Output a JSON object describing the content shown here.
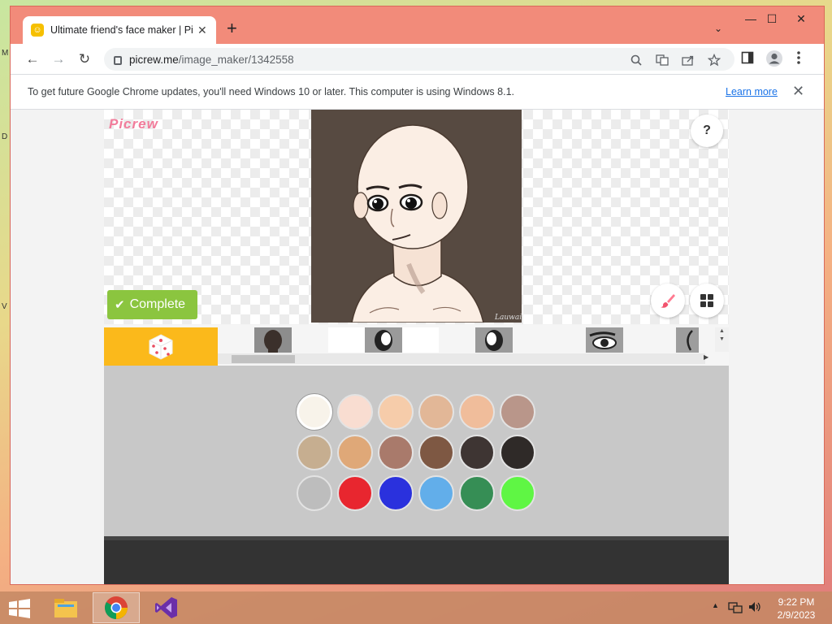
{
  "desktop": {
    "edge_letters": [
      "M",
      "D",
      "V"
    ]
  },
  "browser": {
    "tab": {
      "title": "Ultimate friend's face maker | Picrew",
      "close": "✕"
    },
    "new_tab": "+",
    "tab_search": "⌄",
    "window_controls": {
      "minimize": "—",
      "maximize": "☐",
      "close": "✕"
    },
    "nav": {
      "back": "←",
      "forward": "→",
      "reload": "↻"
    },
    "url_host": "picrew.me",
    "url_path": "/image_maker/1342558"
  },
  "infobar": {
    "message": "To get future Google Chrome updates, you'll need Windows 10 or later. This computer is using Windows 8.1.",
    "link": "Learn more",
    "close": "✕"
  },
  "maker": {
    "logo": "Picrew",
    "help": "?",
    "complete_label": "Complete",
    "artist_signature": "Lauwai",
    "parts": [
      {
        "icon": "random-dice-icon"
      },
      {
        "icon": "skin-silhouette-icon"
      },
      {
        "icon": "face-part-1-icon"
      },
      {
        "icon": "face-part-2-icon"
      },
      {
        "icon": "eyes-icon"
      },
      {
        "icon": "eyebrow-icon"
      }
    ],
    "palette": [
      "#f8f3ea",
      "#f9ddd1",
      "#f6ccaa",
      "#e2b797",
      "#f0bd9b",
      "#b9968a",
      "#c6ae90",
      "#dfa878",
      "#a97a6b",
      "#7e5843",
      "#3e3533",
      "#2f2a28",
      "#bdbdbd",
      "#e8262f",
      "#2a31dd",
      "#62aeea",
      "#368e55",
      "#5ff644"
    ],
    "selected_swatch_index": 0
  },
  "taskbar": {
    "apps": [
      "file-explorer-icon",
      "chrome-icon",
      "visual-studio-icon"
    ],
    "time": "9:22 PM",
    "date": "2/9/2023"
  }
}
